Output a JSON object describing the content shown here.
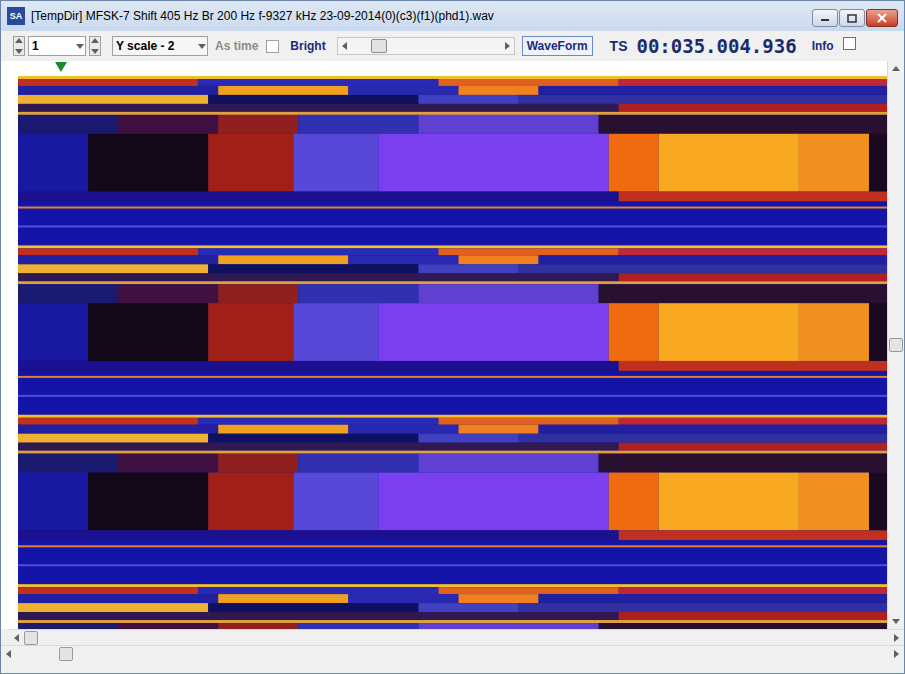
{
  "window": {
    "title": "[TempDir] MFSK-7 Shift 405 Hz Br 200 Hz f-9327 kHz 23-09-2014(0)(c3)(f1)(phd1).wav",
    "app_icon": "SA"
  },
  "toolbar": {
    "channel": "1",
    "y_scale": "Y scale - 2",
    "checkboxes": [
      {
        "label": "As time",
        "checked": false,
        "disabled": true
      },
      {
        "label": "Bright",
        "checked": false,
        "disabled": false
      }
    ],
    "slider": {
      "level": 0.15
    },
    "waveform_button": "WaveForm",
    "ts_label": "TS",
    "time": "00:035.004.936",
    "info": {
      "label": "Info",
      "checked": false
    }
  },
  "marker": {
    "level": 0.05
  },
  "scrollbars": {
    "vertical": {
      "level": 0.5
    },
    "horizontal": {
      "level": 0.0
    },
    "horizontal_lower": {
      "level": 0.05
    }
  }
}
